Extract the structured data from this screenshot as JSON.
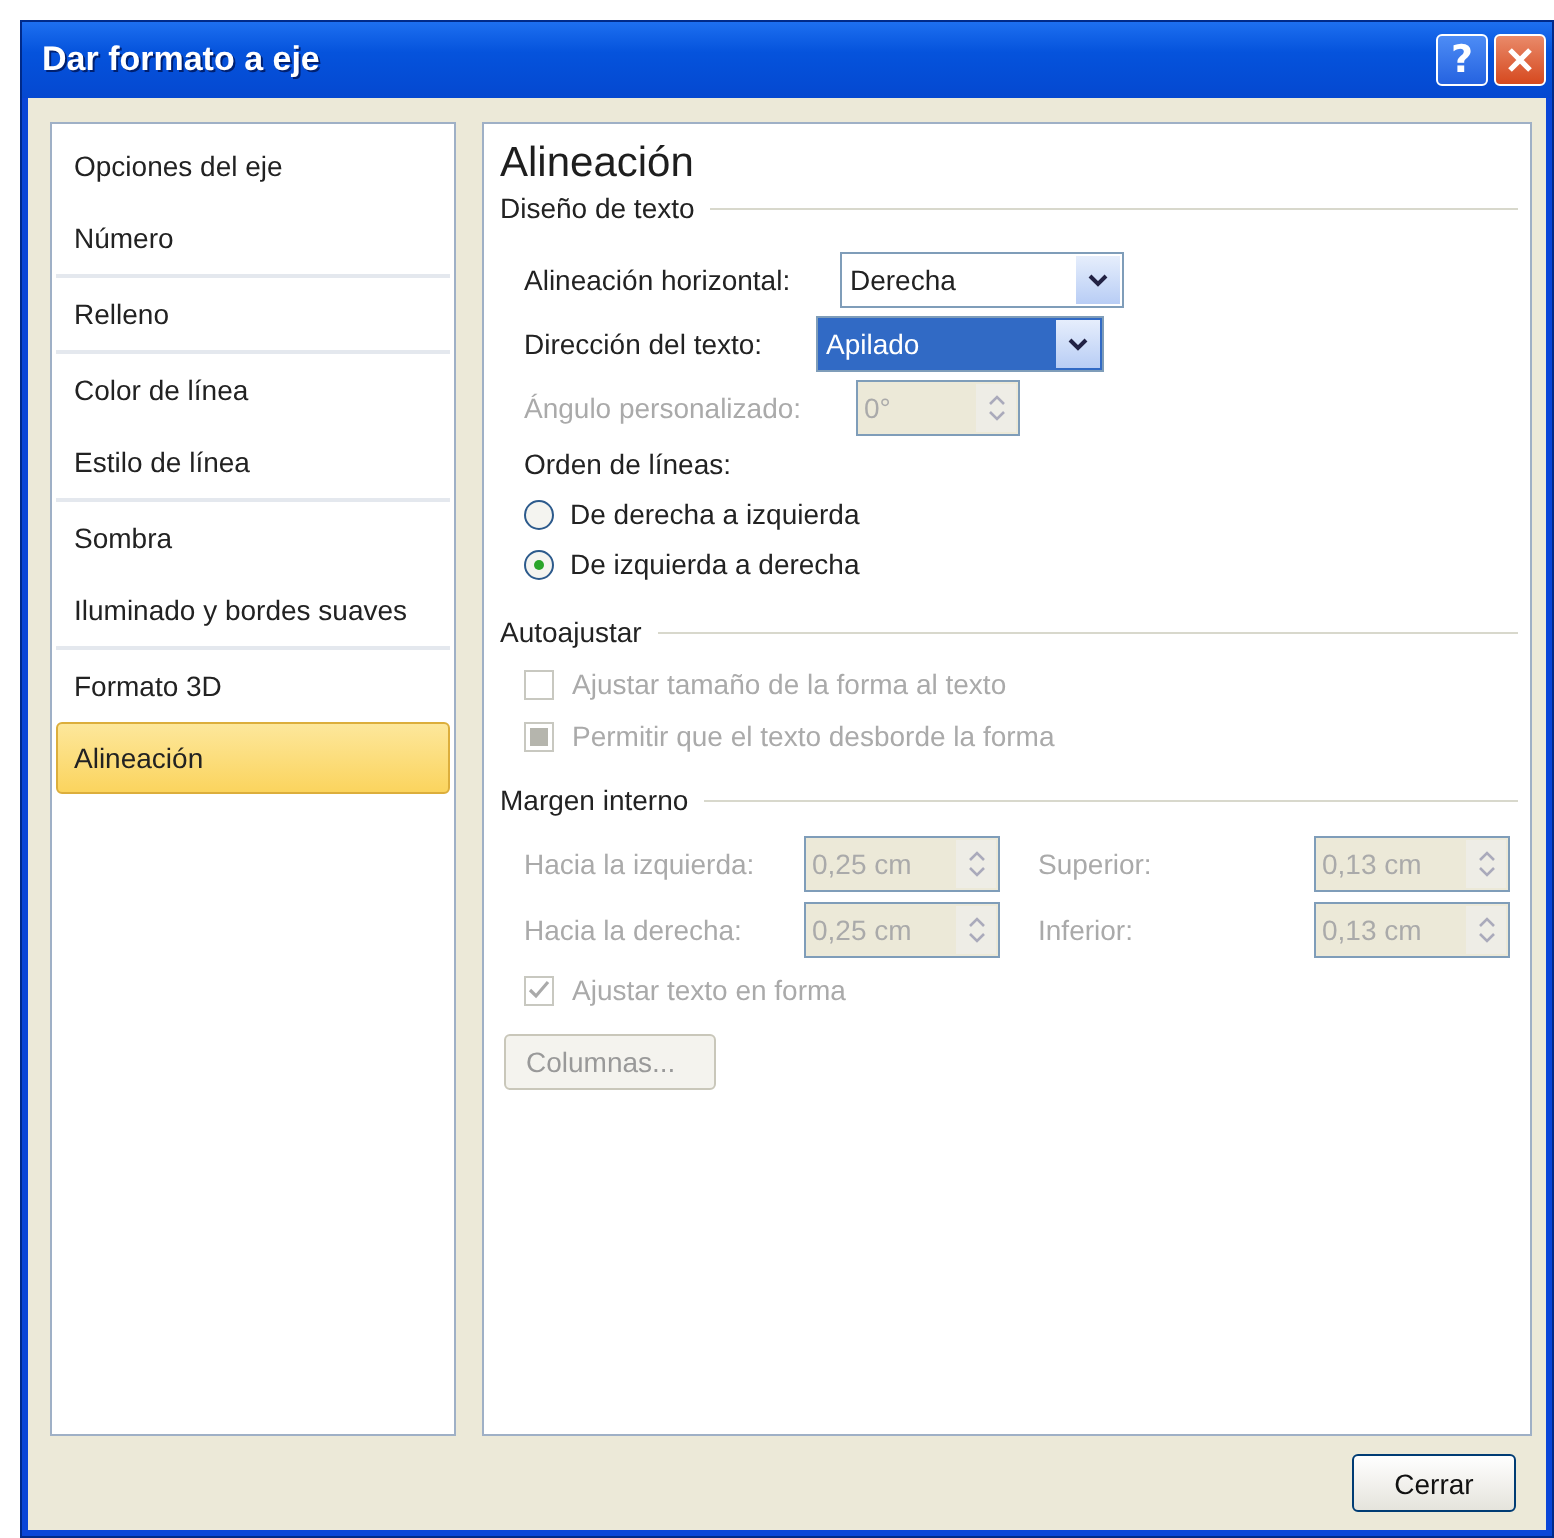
{
  "window": {
    "title": "Dar formato a eje",
    "help": "?"
  },
  "sidebar": {
    "groups": [
      {
        "items": [
          {
            "label": "Opciones del eje",
            "selected": false
          },
          {
            "label": "Número",
            "selected": false
          }
        ]
      },
      {
        "items": [
          {
            "label": "Relleno",
            "selected": false
          }
        ]
      },
      {
        "items": [
          {
            "label": "Color de línea",
            "selected": false
          },
          {
            "label": "Estilo de línea",
            "selected": false
          }
        ]
      },
      {
        "items": [
          {
            "label": "Sombra",
            "selected": false
          },
          {
            "label": "Iluminado y bordes suaves",
            "selected": false
          }
        ]
      },
      {
        "items": [
          {
            "label": "Formato 3D",
            "selected": false
          },
          {
            "label": "Alineación",
            "selected": true
          }
        ]
      }
    ]
  },
  "panel": {
    "title": "Alineación",
    "text_design": {
      "heading": "Diseño de texto",
      "horizontal_alignment": {
        "label": "Alineación horizontal:",
        "value": "Derecha",
        "focused": false
      },
      "text_direction": {
        "label": "Dirección del texto:",
        "value": "Apilado",
        "focused": true
      },
      "custom_angle": {
        "label": "Ángulo personalizado:",
        "value": "0°",
        "disabled": true
      },
      "line_order": {
        "label": "Orden de líneas:",
        "options": [
          {
            "label": "De derecha a izquierda",
            "selected": false
          },
          {
            "label": "De izquierda a derecha",
            "selected": true
          }
        ]
      }
    },
    "autofit": {
      "heading": "Autoajustar",
      "options": [
        {
          "label": "Ajustar tamaño de la forma al texto",
          "checked": false,
          "disabled": true
        },
        {
          "label": "Permitir que el texto desborde la forma",
          "checked": false,
          "mixed": true,
          "disabled": true
        }
      ]
    },
    "internal_margin": {
      "heading": "Margen interno",
      "fields": [
        {
          "label": "Hacia la izquierda:",
          "value": "0,25 cm",
          "disabled": true
        },
        {
          "label": "Superior:",
          "value": "0,13 cm",
          "disabled": true
        },
        {
          "label": "Hacia la derecha:",
          "value": "0,25 cm",
          "disabled": true
        },
        {
          "label": "Inferior:",
          "value": "0,13 cm",
          "disabled": true
        }
      ],
      "wrap_text": {
        "label": "Ajustar texto en forma",
        "checked": true,
        "disabled": true
      },
      "columns_button": {
        "label": "Columnas...",
        "disabled": true
      }
    }
  },
  "close_button": {
    "label": "Cerrar"
  }
}
